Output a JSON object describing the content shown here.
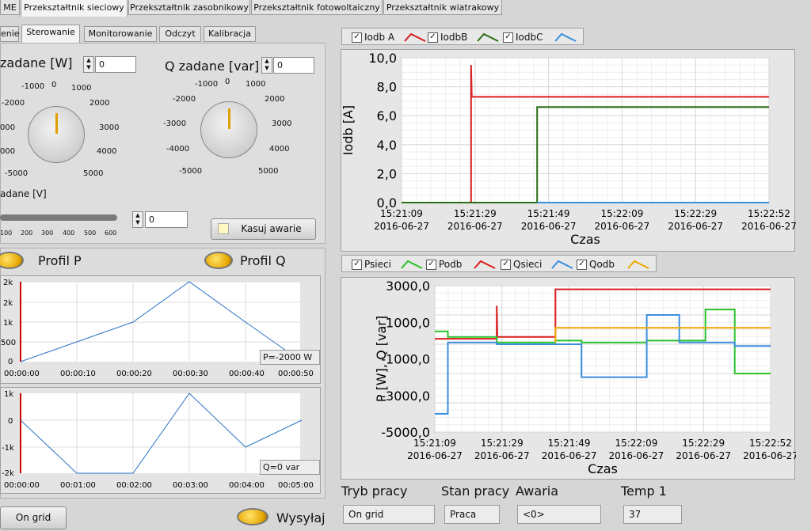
{
  "top_tabs": [
    {
      "label": "ME",
      "active": false
    },
    {
      "label": "Przekształtnik sieciowy",
      "active": true
    },
    {
      "label": "Przekształtnik zasobnikowy",
      "active": false
    },
    {
      "label": "Przekształtnik fotowoltaiczny",
      "active": false
    },
    {
      "label": "Przekształtnik wiatrakowy",
      "active": false
    }
  ],
  "sub_tabs": [
    {
      "label": "enie",
      "active": false
    },
    {
      "label": "Sterowanie",
      "active": true
    },
    {
      "label": "Monitorowanie",
      "active": false
    },
    {
      "label": "Odczyt",
      "active": false
    },
    {
      "label": "Kalibracja",
      "active": false
    }
  ],
  "controls": {
    "p_label": "zadane [W]",
    "p_value": "0",
    "q_label": "Q zadane [var]",
    "q_value": "0",
    "p_knob_ticks": [
      "-2000",
      "-1000",
      "0",
      "1000",
      "2000",
      "3000",
      "4000",
      "-5000",
      "5000",
      "000",
      "000"
    ],
    "q_knob_ticks": [
      "-1000",
      "0",
      "1000",
      "-2000",
      "2000",
      "-3000",
      "3000",
      "-4000",
      "4000",
      "-5000",
      "5000"
    ],
    "u_label": "adane [V]",
    "slider_ticks": [
      "100",
      "200",
      "300",
      "400",
      "500",
      "600"
    ],
    "u_value": "0",
    "reset_button": "Kasuj awarie",
    "profil_p": "Profil P",
    "profil_q": "Profil Q",
    "on_grid_button": "On grid",
    "send_label": "Wysyłaj"
  },
  "profile_p": {
    "y_ticks": [
      "2k",
      "2k",
      "1k",
      "500",
      "0"
    ],
    "x_ticks": [
      "00:00:00",
      "00:00:10",
      "00:00:20",
      "00:00:30",
      "00:00:40",
      "00:00:50"
    ],
    "readout": "P=-2000 W"
  },
  "profile_q": {
    "y_ticks": [
      "1k",
      "0",
      "-1k",
      "-2k"
    ],
    "x_ticks": [
      "00:00:00",
      "00:01:00",
      "00:02:00",
      "00:03:00",
      "00:04:00",
      "00:05:00"
    ],
    "readout": "Q=0 var"
  },
  "legend_top": [
    "Iodb A",
    "IodbB",
    "IodbC"
  ],
  "legend_bottom": [
    "Psieci",
    "Podb",
    "Qsieci",
    "Qodb"
  ],
  "colors": {
    "red": "#d81e1e",
    "green": "#2a6e12",
    "blue": "#3a8ee0",
    "lgreen": "#29c229",
    "orange": "#f0a800",
    "profile": "#2a73c5"
  },
  "chart_data": [
    {
      "type": "line",
      "ylabel": "Iodb [A]",
      "xlabel": "Czas",
      "ylim": [
        0,
        10
      ],
      "y_ticks": [
        "10,0",
        "8,0",
        "6,0",
        "4,0",
        "2,0",
        "0,0"
      ],
      "x_ticks": [
        {
          "time": "15:21:09",
          "date": "2016-06-27"
        },
        {
          "time": "15:21:29",
          "date": "2016-06-27"
        },
        {
          "time": "15:21:49",
          "date": "2016-06-27"
        },
        {
          "time": "15:22:09",
          "date": "2016-06-27"
        },
        {
          "time": "15:22:29",
          "date": "2016-06-27"
        },
        {
          "time": "15:22:52",
          "date": "2016-06-27"
        }
      ],
      "x_range_seconds": [
        0,
        103
      ],
      "series": [
        {
          "name": "IodbA",
          "color": "#d81e1e",
          "points": [
            [
              0,
              0
            ],
            [
              19.5,
              0
            ],
            [
              19.5,
              9.5
            ],
            [
              19.7,
              7.3
            ],
            [
              103,
              7.3
            ]
          ]
        },
        {
          "name": "IodbB",
          "color": "#2a6e12",
          "points": [
            [
              0,
              0
            ],
            [
              38,
              0
            ],
            [
              38,
              6.6
            ],
            [
              103,
              6.6
            ]
          ]
        },
        {
          "name": "IodbC",
          "color": "#3a8ee0",
          "points": [
            [
              38,
              0
            ],
            [
              103,
              0
            ]
          ]
        }
      ]
    },
    {
      "type": "line",
      "ylabel": "P [W], Q [var]",
      "xlabel": "Czas",
      "ylim": [
        -5000,
        3000
      ],
      "y_ticks": [
        "3000,0",
        "1000,0",
        "-1000,0",
        "-3000,0",
        "-5000,0"
      ],
      "x_ticks": [
        {
          "time": "15:21:09",
          "date": "2016-06-27"
        },
        {
          "time": "15:21:29",
          "date": "2016-06-27"
        },
        {
          "time": "15:21:49",
          "date": "2016-06-27"
        },
        {
          "time": "15:22:09",
          "date": "2016-06-27"
        },
        {
          "time": "15:22:29",
          "date": "2016-06-27"
        },
        {
          "time": "15:22:52",
          "date": "2016-06-27"
        }
      ],
      "x_range_seconds": [
        0,
        103
      ],
      "series": [
        {
          "name": "Qsieci",
          "color": "#d81e1e",
          "points": [
            [
              0,
              100
            ],
            [
              19,
              100
            ],
            [
              19,
              1900
            ],
            [
              19.2,
              200
            ],
            [
              37,
              200
            ],
            [
              37,
              2800
            ],
            [
              103,
              2800
            ]
          ]
        },
        {
          "name": "Psieci",
          "color": "#29c229",
          "points": [
            [
              0,
              500
            ],
            [
              4,
              500
            ],
            [
              4,
              200
            ],
            [
              19,
              200
            ],
            [
              19,
              -100
            ],
            [
              37,
              -100
            ],
            [
              37,
              0
            ],
            [
              45,
              0
            ],
            [
              45,
              -100
            ],
            [
              65,
              -100
            ],
            [
              65,
              0
            ],
            [
              83,
              0
            ],
            [
              83,
              1700
            ],
            [
              92,
              1700
            ],
            [
              92,
              -1800
            ],
            [
              103,
              -1800
            ]
          ]
        },
        {
          "name": "Qodb",
          "color": "#3a8ee0",
          "points": [
            [
              0,
              -4000
            ],
            [
              4,
              -4000
            ],
            [
              4,
              -100
            ],
            [
              19,
              -100
            ],
            [
              19,
              -200
            ],
            [
              45,
              -200
            ],
            [
              45,
              -2000
            ],
            [
              65,
              -2000
            ],
            [
              65,
              1400
            ],
            [
              75,
              1400
            ],
            [
              75,
              -100
            ],
            [
              92,
              -100
            ],
            [
              92,
              -300
            ],
            [
              103,
              -300
            ]
          ]
        },
        {
          "name": "Podb",
          "color": "#f0a800",
          "points": [
            [
              37,
              -100
            ],
            [
              37,
              700
            ],
            [
              103,
              700
            ]
          ]
        }
      ]
    }
  ],
  "indicators": [
    {
      "label": "Tryb pracy",
      "value": "On grid"
    },
    {
      "label": "Stan pracy",
      "value": "Praca"
    },
    {
      "label": "Awaria",
      "value": "<0>"
    },
    {
      "label": "Temp 1",
      "value": "37"
    }
  ]
}
